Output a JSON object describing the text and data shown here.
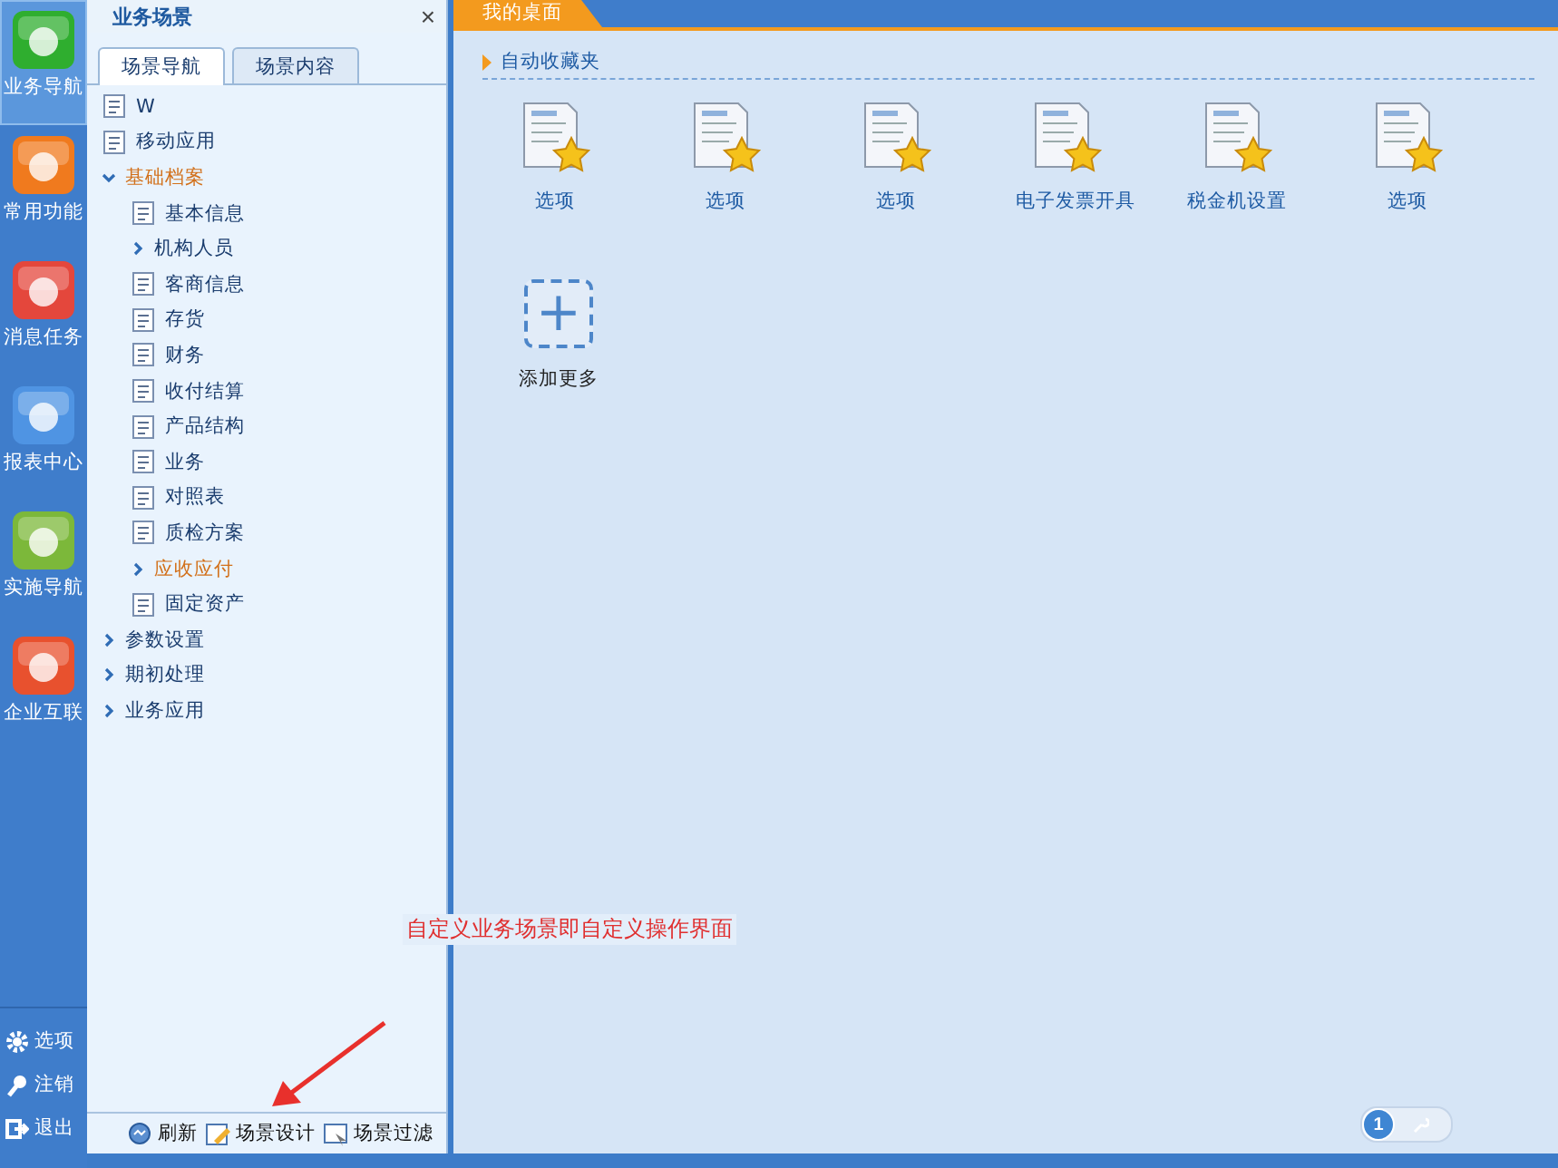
{
  "rail": {
    "items": [
      {
        "label": "业务导航",
        "selected": true
      },
      {
        "label": "常用功能",
        "selected": false
      },
      {
        "label": "消息任务",
        "selected": false
      },
      {
        "label": "报表中心",
        "selected": false
      },
      {
        "label": "实施导航",
        "selected": false
      },
      {
        "label": "企业互联",
        "selected": false
      }
    ],
    "bottom": [
      {
        "kind": "gear",
        "label": "选项"
      },
      {
        "kind": "key",
        "label": "注销"
      },
      {
        "kind": "exit",
        "label": "退出"
      }
    ]
  },
  "nav_panel": {
    "title": "业务场景",
    "close": "×",
    "tabs": [
      {
        "label": "场景导航",
        "selected": true
      },
      {
        "label": "场景内容",
        "selected": false
      }
    ],
    "tree": [
      {
        "kind": "page",
        "label": "W",
        "highlighted": false
      },
      {
        "kind": "page",
        "label": "移动应用",
        "highlighted": false
      },
      {
        "kind": "folder",
        "label": "基础档案",
        "expanded": true,
        "highlighted": true,
        "children": [
          {
            "kind": "page",
            "label": "基本信息",
            "highlighted": false
          },
          {
            "kind": "folder",
            "label": "机构人员",
            "expanded": false,
            "highlighted": false
          },
          {
            "kind": "page",
            "label": "客商信息",
            "highlighted": false
          },
          {
            "kind": "page",
            "label": "存货",
            "highlighted": false
          },
          {
            "kind": "page",
            "label": "财务",
            "highlighted": false
          },
          {
            "kind": "page",
            "label": "收付结算",
            "highlighted": false
          },
          {
            "kind": "page",
            "label": "产品结构",
            "highlighted": false
          },
          {
            "kind": "page",
            "label": "业务",
            "highlighted": false
          },
          {
            "kind": "page",
            "label": "对照表",
            "highlighted": false
          },
          {
            "kind": "page",
            "label": "质检方案",
            "highlighted": false
          },
          {
            "kind": "folder",
            "label": "应收应付",
            "expanded": false,
            "highlighted": true
          },
          {
            "kind": "page",
            "label": "固定资产",
            "highlighted": false
          }
        ]
      },
      {
        "kind": "folder",
        "label": "参数设置",
        "expanded": false,
        "highlighted": false
      },
      {
        "kind": "folder",
        "label": "期初处理",
        "expanded": false,
        "highlighted": false
      },
      {
        "kind": "folder",
        "label": "业务应用",
        "expanded": false,
        "highlighted": false
      }
    ],
    "footer": [
      {
        "kind": "refresh",
        "label": "刷新"
      },
      {
        "kind": "design",
        "label": "场景设计"
      },
      {
        "kind": "filter",
        "label": "场景过滤"
      }
    ]
  },
  "main": {
    "tab": "我的桌面",
    "section": "自动收藏夹",
    "favorites": [
      "选项",
      "选项",
      "选项",
      "电子发票开具",
      "税金机设置",
      "选项"
    ],
    "add_more": {
      "symbol": "+",
      "label": "添加更多"
    },
    "annotation": "自定义业务场景即自定义操作界面",
    "pager": {
      "page": "1"
    }
  }
}
